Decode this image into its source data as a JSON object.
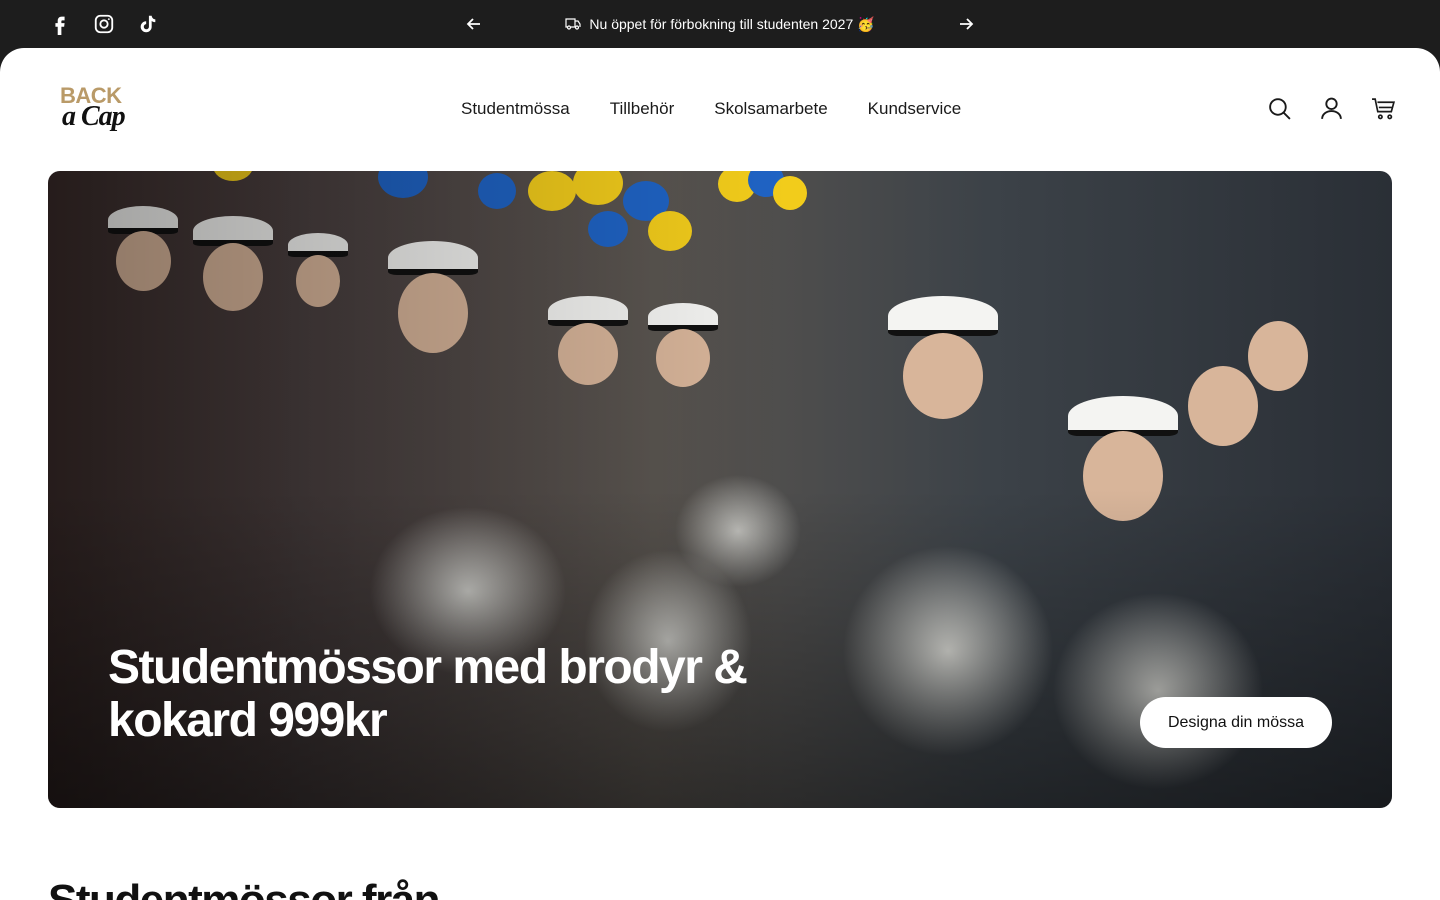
{
  "announcement": {
    "social_icons": [
      "facebook-icon",
      "instagram-icon",
      "tiktok-icon"
    ],
    "message": "Nu öppet för förbokning till studenten 2027 🥳",
    "message_icon": "truck-icon"
  },
  "header": {
    "logo_line1": "BACK",
    "logo_line2": "a Cap",
    "nav": [
      "Studentmössa",
      "Tillbehör",
      "Skolsamarbete",
      "Kundservice"
    ],
    "icons": [
      "search-icon",
      "account-icon",
      "cart-icon"
    ]
  },
  "hero": {
    "title": "Studentmössor med brodyr & kokard 999kr",
    "button_label": "Designa din mössa"
  },
  "section": {
    "title": "Studentmössor från"
  },
  "colors": {
    "bar_bg": "#1d1d1d",
    "logo_gold": "#b99a68",
    "balloon_yellow": "#f2cc1b",
    "balloon_blue": "#1f63c4"
  }
}
